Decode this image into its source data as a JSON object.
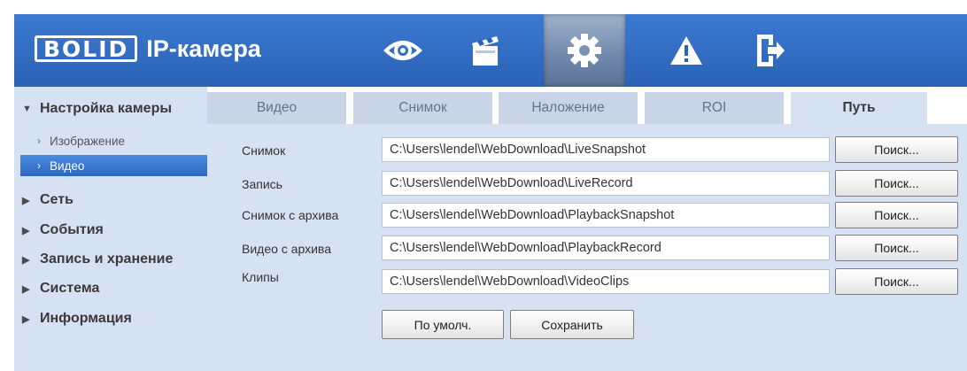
{
  "header": {
    "logo_brand": "BOLID",
    "logo_product": "IP-камера",
    "nav": [
      {
        "icon": "eye-icon",
        "active": false
      },
      {
        "icon": "clapperboard-icon",
        "active": false
      },
      {
        "icon": "gear-icon",
        "active": true
      },
      {
        "icon": "warning-icon",
        "active": false
      },
      {
        "icon": "logout-icon",
        "active": false
      }
    ]
  },
  "sidebar": {
    "camera_settings": "Настройка камеры",
    "image": "Изображение",
    "video": "Видео",
    "network": "Сеть",
    "events": "События",
    "record_storage": "Запись и хранение",
    "system": "Система",
    "info": "Информация"
  },
  "tabs": {
    "video": "Видео",
    "snapshot": "Снимок",
    "overlay": "Наложение",
    "roi": "ROI",
    "path": "Путь"
  },
  "paths": {
    "rows": [
      {
        "label": "Снимок",
        "value": "C:\\Users\\lendel\\WebDownload\\LiveSnapshot"
      },
      {
        "label": "Запись",
        "value": "C:\\Users\\lendel\\WebDownload\\LiveRecord"
      },
      {
        "label": "Снимок с архива",
        "value": "C:\\Users\\lendel\\WebDownload\\PlaybackSnapshot"
      },
      {
        "label": "Видео с архива",
        "value": "C:\\Users\\lendel\\WebDownload\\PlaybackRecord"
      },
      {
        "label": "Клипы",
        "value": "C:\\Users\\lendel\\WebDownload\\VideoClips"
      }
    ],
    "browse_label": "Поиск..."
  },
  "actions": {
    "default_label": "По умолч.",
    "save_label": "Сохранить"
  }
}
